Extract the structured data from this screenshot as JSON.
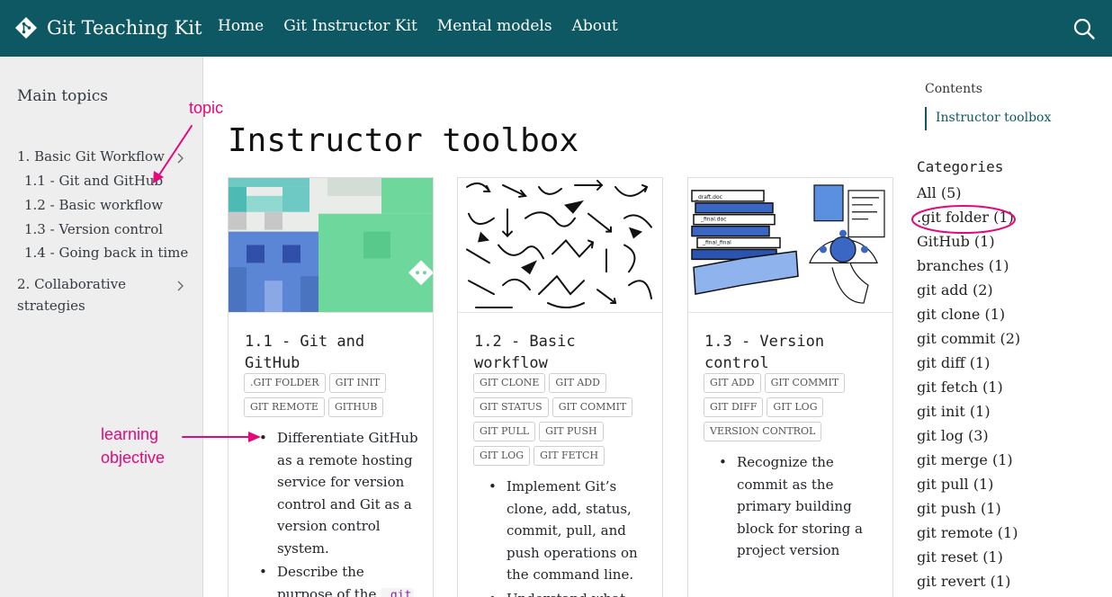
{
  "navbar": {
    "brand_title": "Git Teaching Kit",
    "links": [
      "Home",
      "Git Instructor Kit",
      "Mental models",
      "About"
    ],
    "search_icon": "search-icon",
    "brand_icon": "git-logo-icon",
    "background_color": "#0e5863"
  },
  "sidebar": {
    "heading": "Main topics",
    "sections": [
      {
        "label": "1. Basic Git Workflow",
        "items": [
          "1.1 - Git and GitHub",
          "1.2 - Basic workflow",
          "1.3 - Version control",
          "1.4 - Going back in time"
        ]
      },
      {
        "label_line1": "2. Collaborative",
        "label_line2": "strategies"
      }
    ]
  },
  "main": {
    "title": "Instructor toolbox",
    "cards": [
      {
        "title_line1": "1.1 - Git and",
        "title_line2": "GitHub",
        "tags": [
          ".git folder",
          "git init",
          "git remote",
          "GitHub"
        ],
        "objectives": [
          "Differentiate GitHub as a remote hosting service for version control and Git as a version control system.",
          "Describe the purpose of the"
        ],
        "code_fragment": ".git"
      },
      {
        "title_line1": "1.2 - Basic",
        "title_line2": "workflow",
        "tags": [
          "git clone",
          "git add",
          "git status",
          "git commit",
          "git pull",
          "git push",
          "git log",
          "git fetch"
        ],
        "objectives": [
          "Implement Git’s clone, add, status, commit, pull, and push operations on the command line.",
          "Understand what"
        ]
      },
      {
        "title_line1": "1.3 - Version",
        "title_line2": "control",
        "tags": [
          "git add",
          "git commit",
          "git diff",
          "git log",
          "version control"
        ],
        "objectives": [
          "Recognize the commit as the primary building block for storing a project version"
        ]
      }
    ]
  },
  "toc": {
    "heading": "Contents",
    "link": "Instructor toolbox"
  },
  "categories": {
    "heading": "Categories",
    "items": [
      "All (5)",
      ".git folder (1)",
      "GitHub (1)",
      "branches (1)",
      "git add (2)",
      "git clone (1)",
      "git commit (2)",
      "git diff (1)",
      "git fetch (1)",
      "git init (1)",
      "git log (3)",
      "git merge (1)",
      "git pull (1)",
      "git push (1)",
      "git remote (1)",
      "git reset (1)",
      "git revert (1)"
    ]
  },
  "annotations": {
    "topic": "topic",
    "learning_line1": "learning",
    "learning_line2": "objective",
    "color": "#e4087a"
  }
}
